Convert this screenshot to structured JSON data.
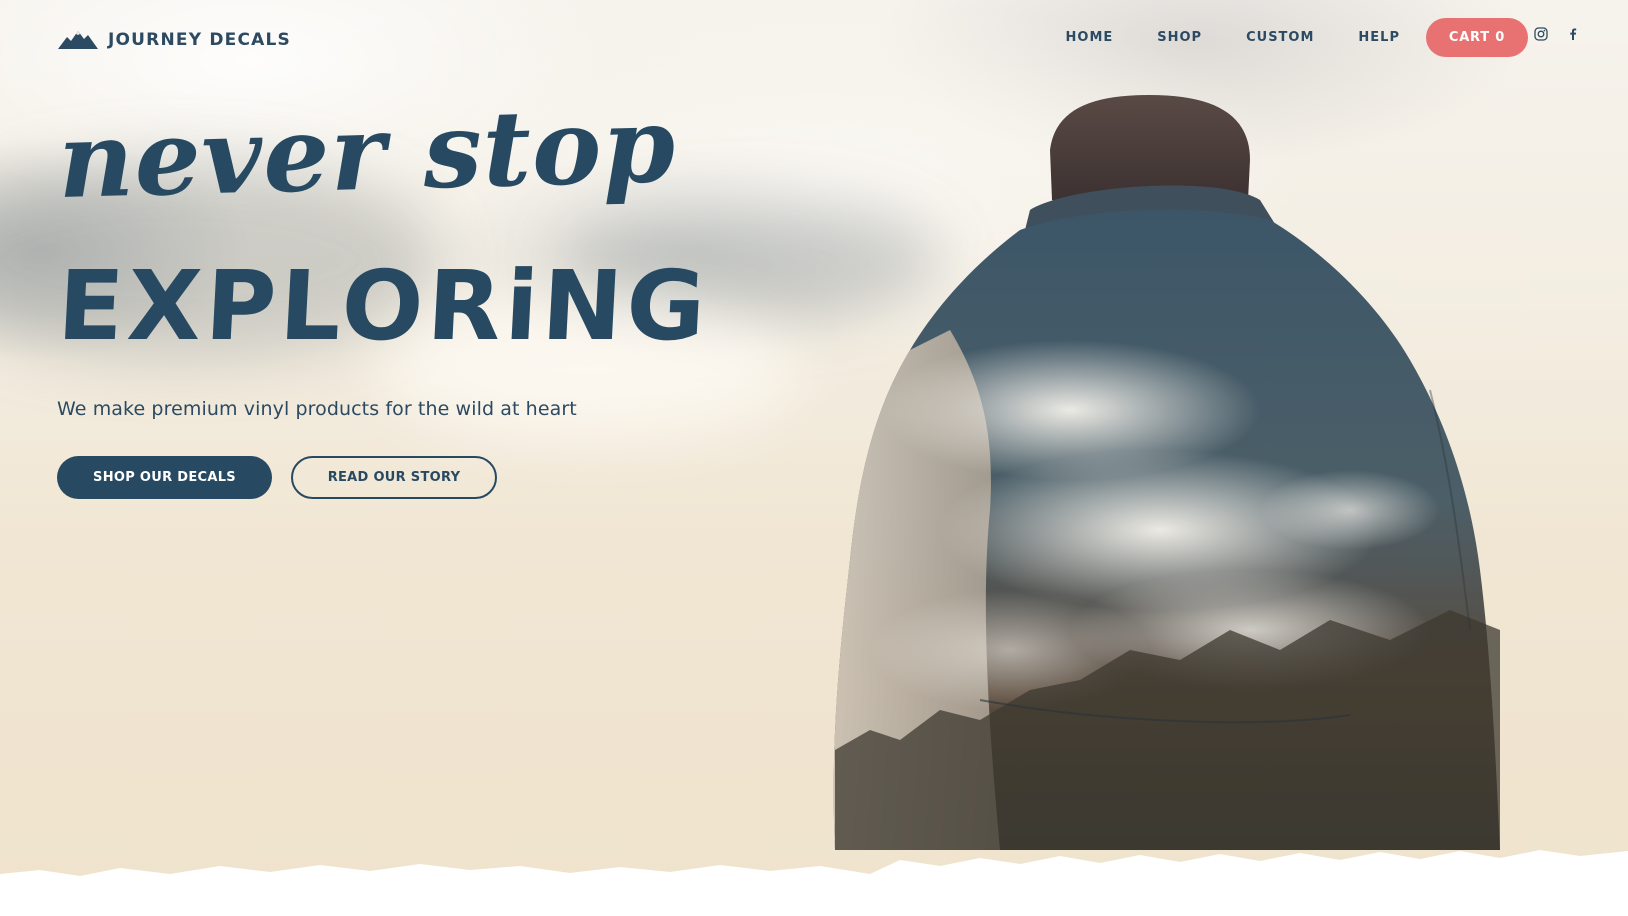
{
  "brand": {
    "name": "JOURNEY DECALS",
    "logo_icon": "mountains-icon",
    "primary_color": "#274a62",
    "accent_color": "#e87272"
  },
  "nav": {
    "items": [
      {
        "label": "HOME"
      },
      {
        "label": "SHOP"
      },
      {
        "label": "CUSTOM"
      },
      {
        "label": "HELP"
      }
    ],
    "cart_label": "CART 0"
  },
  "social": [
    {
      "icon": "instagram-icon"
    },
    {
      "icon": "facebook-icon"
    }
  ],
  "hero": {
    "headline_line1": "never stop",
    "headline_line2": "EXPLORiNG",
    "tagline": "We make premium vinyl products for the wild at heart",
    "primary_button": "SHOP OUR DECALS",
    "secondary_button": "READ OUR STORY"
  }
}
